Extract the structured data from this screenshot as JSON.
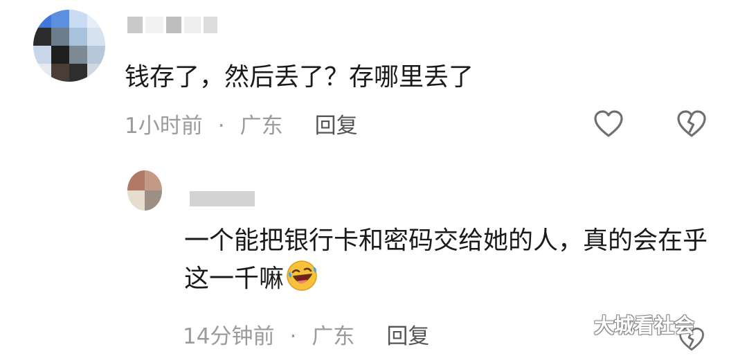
{
  "colors": {
    "meta_text": "#9b9b9b",
    "reply_button": "#555555",
    "comment_text": "#1a1a1a",
    "icon_stroke": "#6f6f6f"
  },
  "comments": [
    {
      "text": "钱存了，然后丢了？存哪里丢了",
      "time": "1小时前",
      "separator": "·",
      "location": "广东",
      "reply_label": "回复",
      "icons": [
        "heart-outline-icon",
        "broken-heart-icon"
      ]
    },
    {
      "text": "一个能把银行卡和密码交给她的人，真的会在乎这一千嘛",
      "emoji": "rolling-laughing-emoji",
      "time": "14分钟前",
      "separator": "·",
      "location": "广东",
      "reply_label": "回复",
      "icons": [
        "broken-heart-icon"
      ]
    }
  ],
  "watermark": "大城看社会"
}
